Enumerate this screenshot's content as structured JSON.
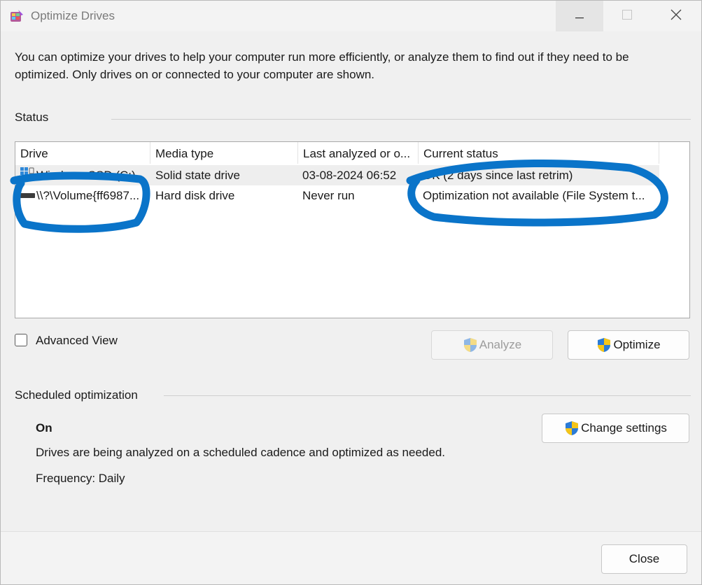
{
  "window": {
    "title": "Optimize Drives"
  },
  "intro": "You can optimize your drives to help your computer run more efficiently, or analyze them to find out if they need to be optimized. Only drives on or connected to your computer are shown.",
  "status_section": {
    "label": "Status",
    "columns": [
      "Drive",
      "Media type",
      "Last analyzed or o...",
      "Current status"
    ],
    "rows": [
      {
        "drive": "Windows SSD (C:)",
        "media": "Solid state drive",
        "last": "03-08-2024 06:52",
        "status": "OK (2 days since last retrim)",
        "icon": "windows-drive-icon"
      },
      {
        "drive": "\\\\?\\Volume{ff6987...",
        "media": "Hard disk drive",
        "last": "Never run",
        "status": "Optimization not available (File System t...",
        "icon": "hard-disk-icon"
      }
    ]
  },
  "advanced_view": {
    "label": "Advanced View",
    "checked": false
  },
  "buttons": {
    "analyze": "Analyze",
    "optimize": "Optimize",
    "change_settings": "Change settings",
    "close": "Close"
  },
  "scheduled": {
    "label": "Scheduled optimization",
    "state": "On",
    "description": "Drives are being analyzed on a scheduled cadence and optimized as needed.",
    "frequency": "Frequency: Daily"
  },
  "annotation_color": "#0a74c9"
}
